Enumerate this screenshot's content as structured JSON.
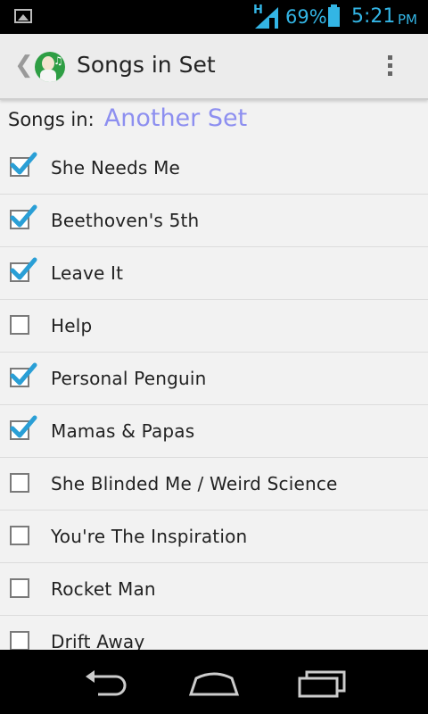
{
  "status_bar": {
    "network": "H",
    "battery_percent": "69%",
    "time": "5:21",
    "ampm": "PM",
    "accent_color": "#33b5e5",
    "icons": [
      "image-icon",
      "signal-icon",
      "battery-icon"
    ]
  },
  "action_bar": {
    "title": "Songs in Set",
    "icons": [
      "up-caret-icon",
      "app-icon",
      "overflow-menu-icon"
    ]
  },
  "header": {
    "label": "Songs in:",
    "set_name": "Another Set",
    "set_name_color": "#8d8ff0"
  },
  "songs": [
    {
      "title": "She Needs Me",
      "checked": true
    },
    {
      "title": "Beethoven's 5th",
      "checked": true
    },
    {
      "title": "Leave It",
      "checked": true
    },
    {
      "title": "Help",
      "checked": false
    },
    {
      "title": "Personal Penguin",
      "checked": true
    },
    {
      "title": "Mamas & Papas",
      "checked": true
    },
    {
      "title": "She Blinded Me / Weird Science",
      "checked": false
    },
    {
      "title": "You're The Inspiration",
      "checked": false
    },
    {
      "title": "Rocket Man",
      "checked": false
    },
    {
      "title": "Drift Away",
      "checked": false
    }
  ],
  "nav_bar": {
    "icons": [
      "back-icon",
      "home-icon",
      "recents-icon"
    ]
  }
}
